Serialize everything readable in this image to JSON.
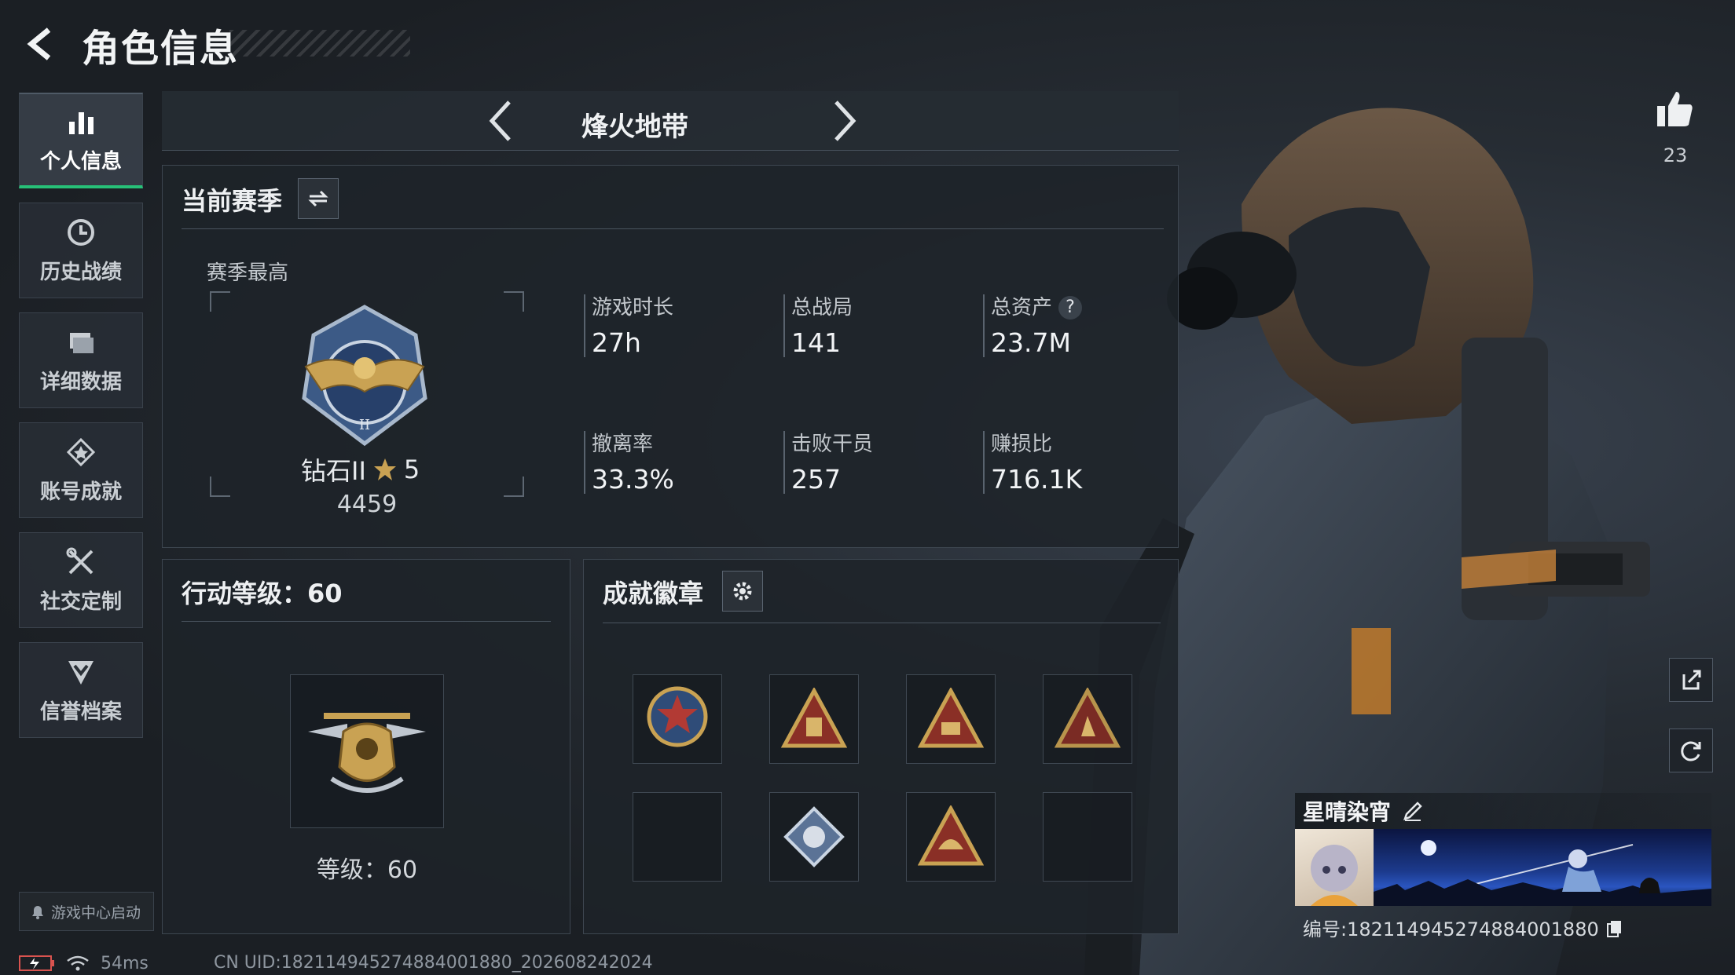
{
  "header": {
    "title": "角色信息"
  },
  "nav": {
    "items": [
      {
        "label": "个人信息",
        "icon": "bar-chart-icon",
        "active": true
      },
      {
        "label": "历史战绩",
        "icon": "history-clock-icon"
      },
      {
        "label": "详细数据",
        "icon": "folder-icon"
      },
      {
        "label": "账号成就",
        "icon": "achievement-star-icon"
      },
      {
        "label": "社交定制",
        "icon": "tools-icon"
      },
      {
        "label": "信誉档案",
        "icon": "shield-chevron-icon"
      }
    ],
    "launch_label": "游戏中心启动"
  },
  "mode": {
    "title": "烽火地带"
  },
  "season": {
    "title": "当前赛季",
    "best_label": "赛季最高",
    "rank_name": "钻石II",
    "rank_stars": "5",
    "rank_score": "4459",
    "stats": [
      {
        "label": "游戏时长",
        "value": "27h"
      },
      {
        "label": "总战局",
        "value": "141"
      },
      {
        "label": "总资产",
        "value": "23.7M",
        "help": "?"
      },
      {
        "label": "撤离率",
        "value": "33.3%"
      },
      {
        "label": "击败干员",
        "value": "257"
      },
      {
        "label": "赚损比",
        "value": "716.1K"
      }
    ]
  },
  "action_level": {
    "title": "行动等级：60",
    "level_text": "等级：60"
  },
  "badges": {
    "title": "成就徽章"
  },
  "likes": {
    "count": "23"
  },
  "player": {
    "name": "星晴染宵",
    "id_text": "编号:18211494527488400188​0"
  },
  "status": {
    "ping": "54ms",
    "uid": "CN UID:18211494527488400188​0_202608242024"
  },
  "colors": {
    "accent_green": "#27c178",
    "gold": "#c9a253"
  }
}
